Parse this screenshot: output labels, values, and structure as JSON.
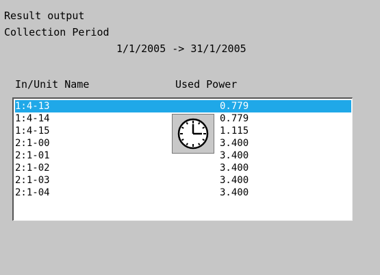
{
  "header": {
    "title": "Result output",
    "period_label": "Collection Period",
    "period_range": "1/1/2005 -> 31/1/2005"
  },
  "table": {
    "columns": {
      "name": "In/Unit Name",
      "power": "Used Power"
    },
    "selected_index": 0,
    "rows": [
      {
        "name": "1:4-13",
        "power": "0.779"
      },
      {
        "name": "1:4-14",
        "power": "0.779"
      },
      {
        "name": "1:4-15",
        "power": "1.115"
      },
      {
        "name": "2:1-00",
        "power": "3.400"
      },
      {
        "name": "2:1-01",
        "power": "3.400"
      },
      {
        "name": "2:1-02",
        "power": "3.400"
      },
      {
        "name": "2:1-03",
        "power": "3.400"
      },
      {
        "name": "2:1-04",
        "power": "3.400"
      }
    ]
  },
  "icons": {
    "busy": "clock-icon"
  },
  "colors": {
    "selection": "#1fa8e8",
    "background": "#c6c6c6"
  }
}
